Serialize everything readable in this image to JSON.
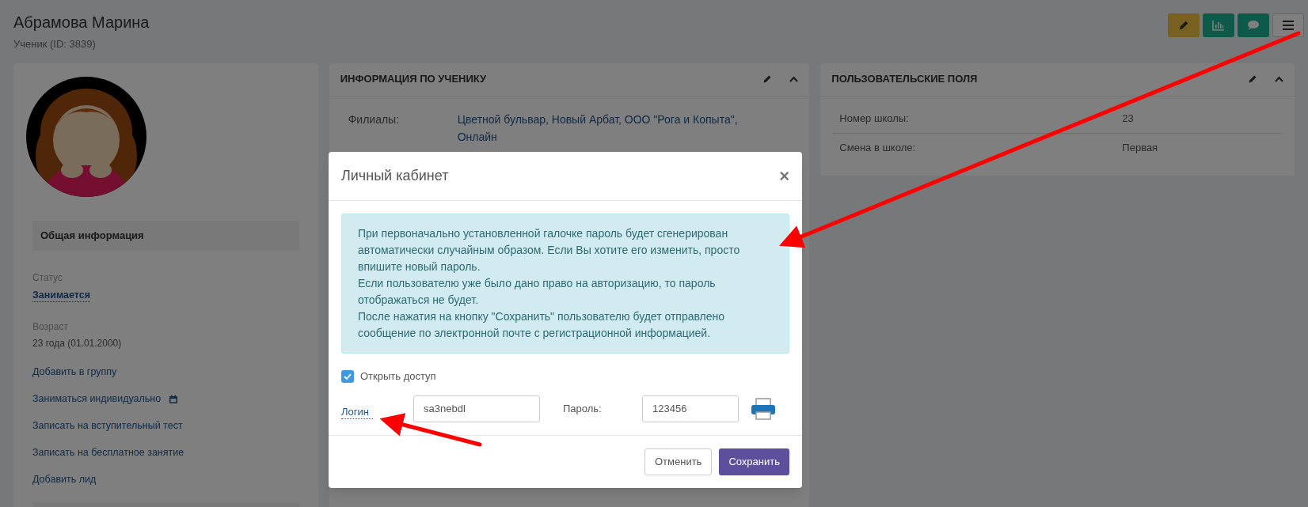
{
  "page": {
    "title": "Абрамова Марина",
    "subtitle": "Ученик (ID: 3839)"
  },
  "toolbar": [
    {
      "kind": "edit"
    },
    {
      "kind": "chart"
    },
    {
      "kind": "comment"
    },
    {
      "kind": "menu"
    }
  ],
  "sidebar": {
    "section": "Общая информация",
    "status_label": "Статус",
    "status": "Занимается",
    "age_label": "Возраст",
    "age": "23 года (01.01.2000)",
    "links": [
      {
        "label": "Добавить в группу",
        "kind": "plain"
      },
      {
        "label": "Заниматься индивидуально",
        "kind": "calendar"
      },
      {
        "label": "Записать на вступительный тест",
        "kind": "plain"
      },
      {
        "label": "Записать на бесплатное занятие",
        "kind": "plain"
      },
      {
        "label": "Добавить лид",
        "kind": "plain"
      }
    ]
  },
  "student_info": {
    "title": "ИНФОРМАЦИЯ ПО УЧЕНИКУ",
    "rows": [
      {
        "label": "Филиалы:",
        "value": "Цветной бульвар, Новый Арбат, ООО \"Рога и Копыта\", Онлайн"
      }
    ]
  },
  "custom_fields": {
    "title": "ПОЛЬЗОВАТЕЛЬСКИЕ ПОЛЯ",
    "rows": [
      {
        "label": "Номер школы:",
        "value": "23"
      },
      {
        "label": "Смена в школе:",
        "value": "Первая"
      }
    ]
  },
  "dialog": {
    "title": "Личный кабинет",
    "close": "×",
    "info": [
      "При первоначально установленной галочке пароль будет сгенерирован автоматически случайным образом. Если Вы хотите его изменить, просто впишите новый пароль.",
      "Если пользователю уже было дано право на авторизацию, то пароль отображаться не будет.",
      "После нажатия на кнопку \"Сохранить\" пользователю будет отправлено сообщение по электронной почте с регистрационной информацией."
    ],
    "access": {
      "label": "Открыть доступ",
      "checked": true
    },
    "login_label": "Логин",
    "login": "sa3nebdl",
    "password_label": "Пароль:",
    "password": "123456",
    "buttons": [
      {
        "label": "Отменить",
        "kind": "default"
      },
      {
        "label": "Сохранить",
        "kind": "primary"
      }
    ]
  }
}
